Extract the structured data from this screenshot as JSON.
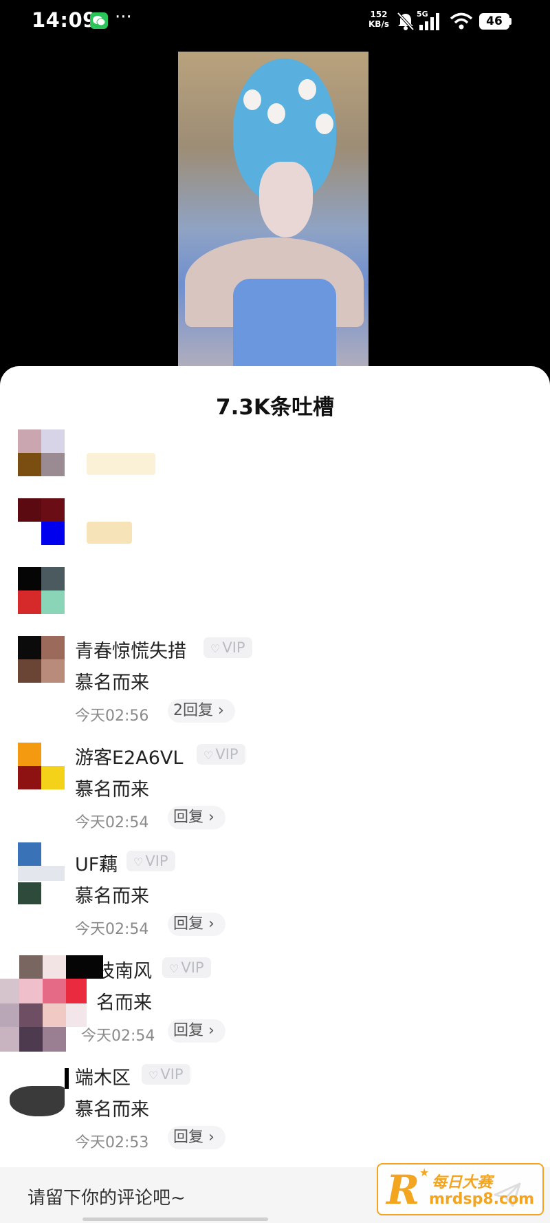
{
  "status_bar": {
    "time": "14:09",
    "dots": "···",
    "net_speed_value": "152",
    "net_speed_unit": "KB/s",
    "network": "5G",
    "battery": "46",
    "icons": [
      "wechat-icon",
      "bell-off-icon",
      "signal-icon",
      "wifi-icon",
      "battery-icon"
    ]
  },
  "sheet": {
    "title": "7.3K条吐槽"
  },
  "comments": [
    {
      "name": "青春惊慌失措",
      "badge": "VIP",
      "text": "慕名而来",
      "time": "今天02:56",
      "reply": "2回复 ›"
    },
    {
      "name": "游客E2A6VL",
      "badge": "VIP",
      "text": "慕名而来",
      "time": "今天02:54",
      "reply": "回复 ›"
    },
    {
      "name": "UF藕",
      "badge": "VIP",
      "text": "慕名而来",
      "time": "今天02:54",
      "reply": "回复 ›"
    },
    {
      "name": "枝南风",
      "badge": "VIP",
      "text": "名而来",
      "time": "今天02:54",
      "reply": "回复 ›"
    },
    {
      "name": "端木区",
      "badge": "VIP",
      "text": "慕名而来",
      "time": "今天02:53",
      "reply": "回复 ›"
    }
  ],
  "input": {
    "placeholder": "请留下你的评论吧~"
  },
  "watermark": {
    "logo_letter": "R",
    "title": "每日大赛",
    "url": "mrdsp8.com"
  }
}
